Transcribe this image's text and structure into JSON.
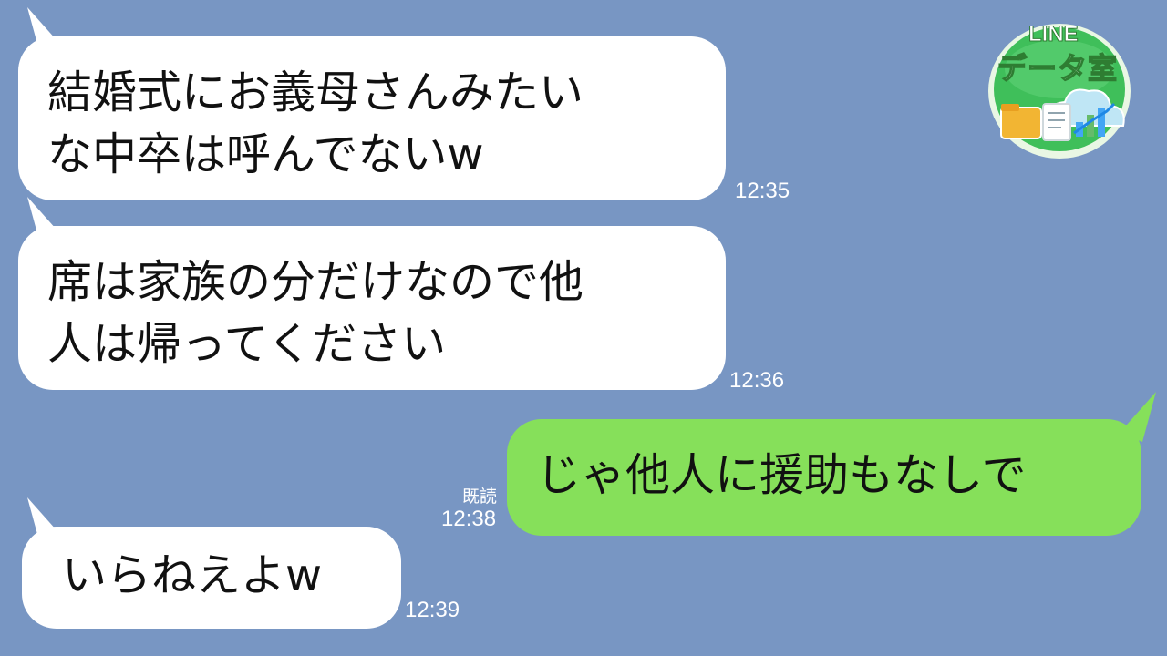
{
  "badge": {
    "line_text": "LINE",
    "title": "データ室"
  },
  "messages": [
    {
      "side": "received",
      "text": "結婚式にお義母さんみたい\nな中卒は呼んでないw",
      "time": "12:35"
    },
    {
      "side": "received",
      "text": "席は家族の分だけなので他\n人は帰ってください",
      "time": "12:36"
    },
    {
      "side": "sent",
      "text": "じゃ他人に援助もなしで",
      "read": "既読",
      "time": "12:38"
    },
    {
      "side": "received",
      "text": "いらねえよw",
      "time": "12:39"
    }
  ],
  "colors": {
    "background": "#7896c3",
    "received_bubble": "#ffffff",
    "sent_bubble": "#86e05a",
    "logo_green": "#3fbf5a"
  }
}
